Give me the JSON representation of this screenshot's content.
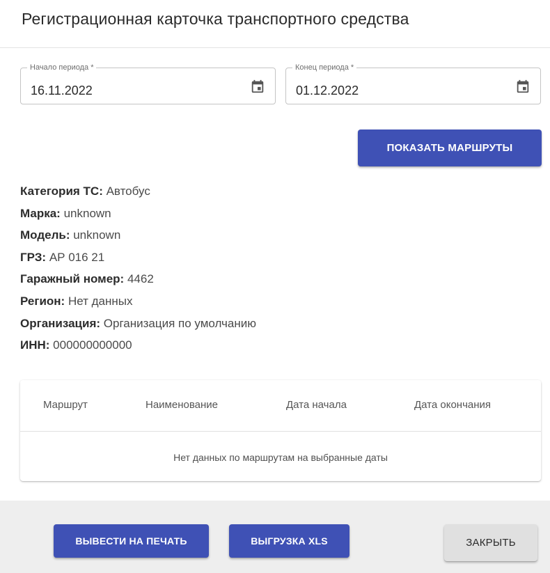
{
  "dialog": {
    "title": "Регистрационная карточка транспортного средства"
  },
  "period": {
    "start_label": "Начало периода *",
    "start_value": "16.11.2022",
    "end_label": "Конец периода *",
    "end_value": "01.12.2022",
    "calendar_icon": "calendar-icon"
  },
  "actions": {
    "show_routes": "ПОКАЗАТЬ МАРШРУТЫ"
  },
  "vehicle": {
    "category_label": "Категория ТС:",
    "category_value": "Автобус",
    "brand_label": "Марка:",
    "brand_value": "unknown",
    "model_label": "Модель:",
    "model_value": "unknown",
    "plate_label": "ГРЗ:",
    "plate_value": "АР 016 21",
    "garage_label": "Гаражный номер:",
    "garage_value": "4462",
    "region_label": "Регион:",
    "region_value": "Нет данных",
    "org_label": "Организация:",
    "org_value": "Организация по умолчанию",
    "inn_label": "ИНН:",
    "inn_value": "000000000000"
  },
  "routes_table": {
    "columns": [
      "Маршрут",
      "Наименование",
      "Дата начала",
      "Дата окончания"
    ],
    "empty_message": "Нет данных по маршрутам на выбранные даты"
  },
  "footer": {
    "print": "ВЫВЕСТИ НА ПЕЧАТЬ",
    "export_xls": "ВЫГРУЗКА XLS",
    "close": "ЗАКРЫТЬ"
  },
  "colors": {
    "primary": "#3f51b5",
    "footer_bg": "#eeeeee",
    "close_button": "#e0e0e0"
  }
}
